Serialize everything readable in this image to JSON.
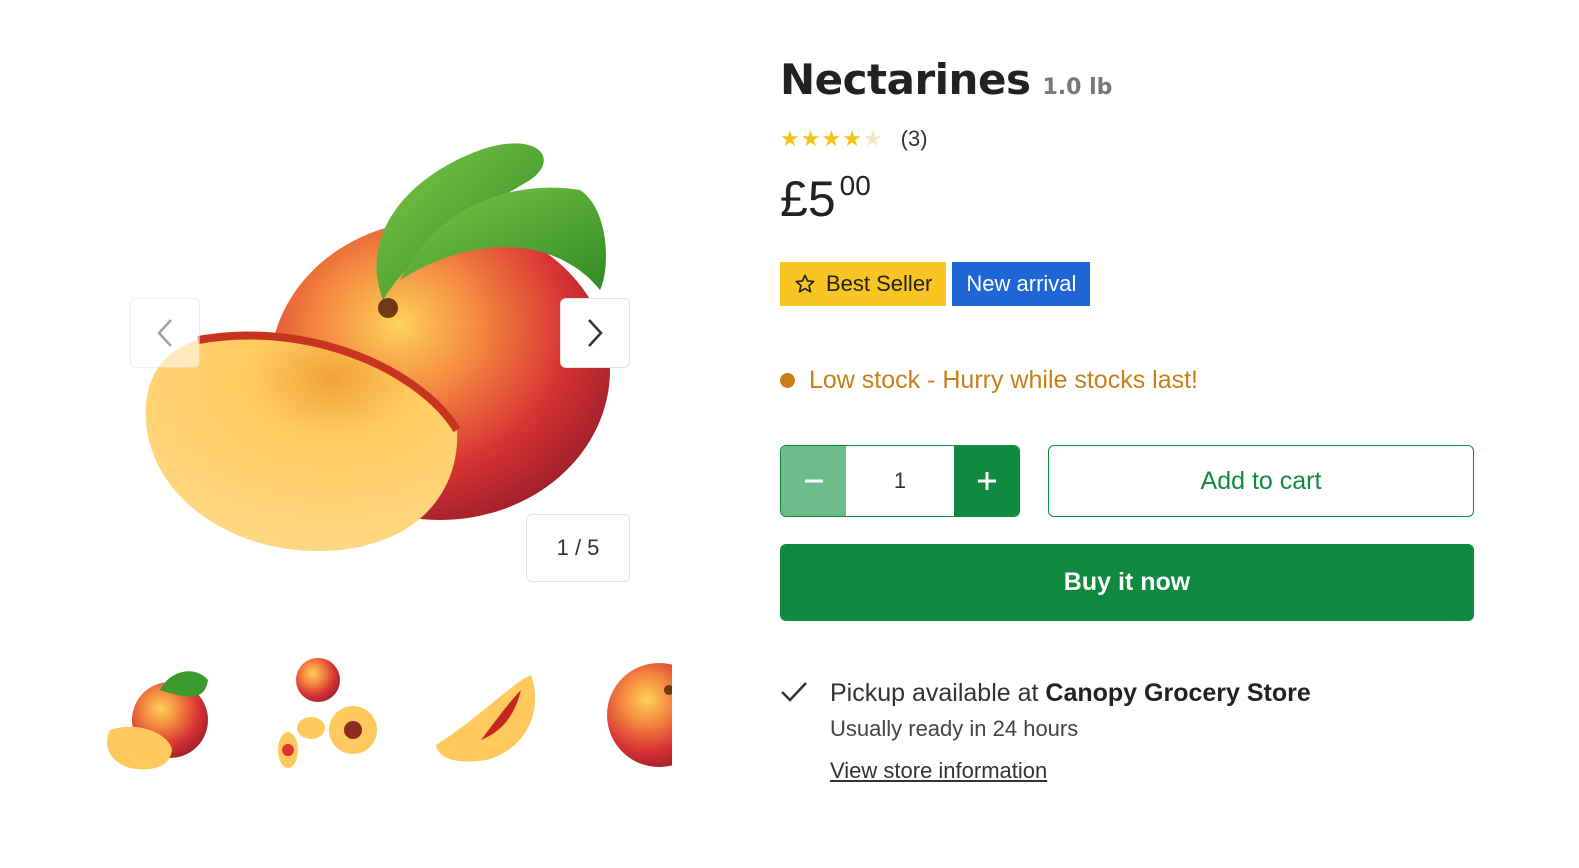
{
  "product": {
    "title": "Nectarines",
    "weight": "1.0 lb",
    "rating": {
      "value": 4,
      "max": 5,
      "count_label": "(3)"
    },
    "price": {
      "currency": "£",
      "whole": "5",
      "cents": "00"
    }
  },
  "badges": {
    "best_seller": "Best Seller",
    "new_arrival": "New arrival"
  },
  "stock": {
    "label": "Low stock - Hurry while stocks last!",
    "color": "#c97f18"
  },
  "gallery": {
    "counter": "1 / 5",
    "prev_icon": "chevron-left-icon",
    "next_icon": "chevron-right-icon"
  },
  "purchase": {
    "quantity": "1",
    "add_to_cart": "Add to cart",
    "buy_now": "Buy it now"
  },
  "pickup": {
    "prefix": "Pickup available at ",
    "store": "Canopy Grocery Store",
    "ready": "Usually ready in 24 hours",
    "link": "View store information"
  },
  "colors": {
    "primary_green": "#0f8a3f",
    "light_green": "#6dbb8b",
    "badge_yellow": "#f9c522",
    "badge_blue": "#1f66d6",
    "star": "#f5c518"
  }
}
